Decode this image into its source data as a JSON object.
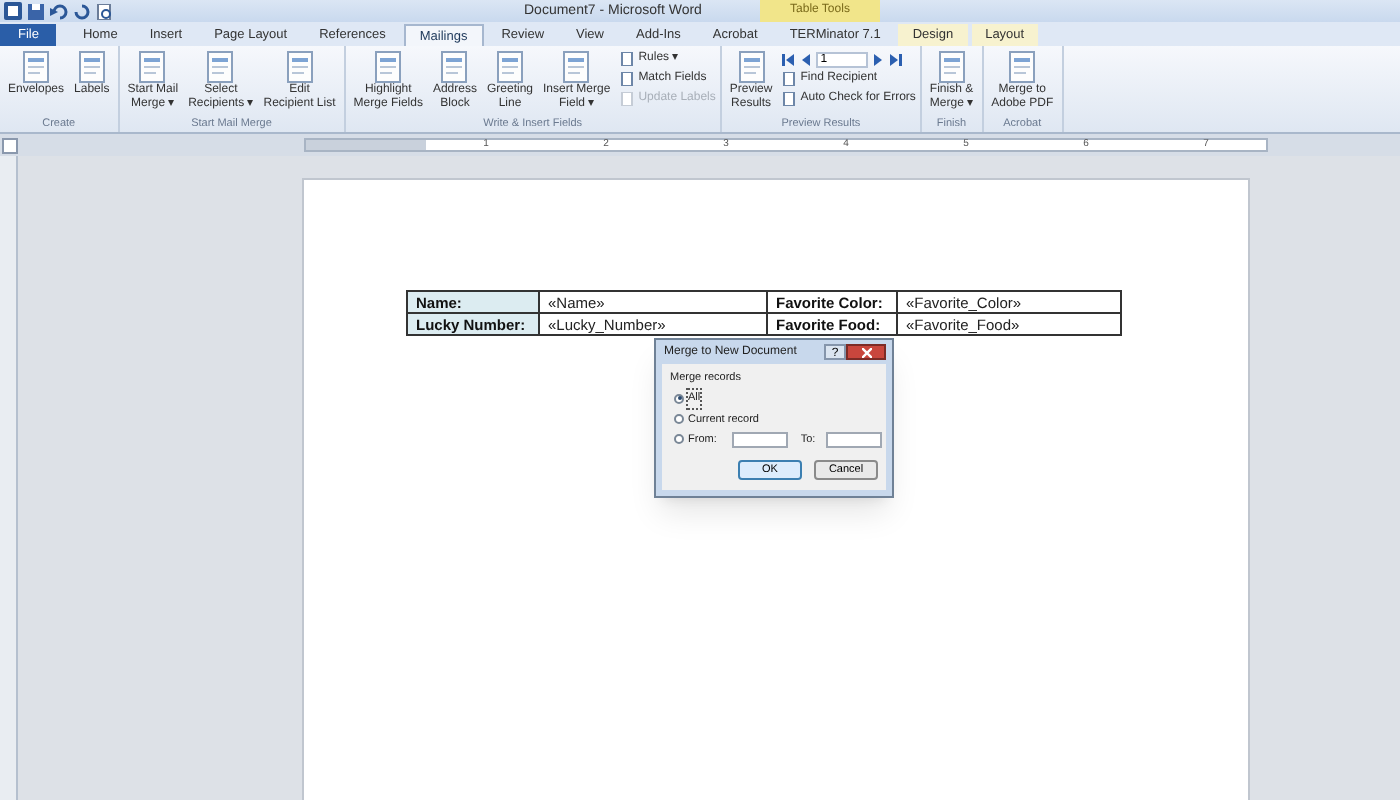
{
  "window": {
    "title": "Document7 - Microsoft Word"
  },
  "contextual_header": "Table Tools",
  "tabs": [
    {
      "label": "File",
      "kind": "file",
      "selected": false
    },
    {
      "label": "Home",
      "selected": false
    },
    {
      "label": "Insert",
      "selected": false
    },
    {
      "label": "Page Layout",
      "selected": false
    },
    {
      "label": "References",
      "selected": false
    },
    {
      "label": "Mailings",
      "selected": true
    },
    {
      "label": "Review",
      "selected": false
    },
    {
      "label": "View",
      "selected": false
    },
    {
      "label": "Add-Ins",
      "selected": false
    },
    {
      "label": "Acrobat",
      "selected": false
    },
    {
      "label": "TERMinator 7.1",
      "selected": false
    },
    {
      "label": "Design",
      "kind": "contextual",
      "selected": false
    },
    {
      "label": "Layout",
      "kind": "contextual",
      "selected": false
    }
  ],
  "ribbon_groups": [
    {
      "label": "Create",
      "items": [
        {
          "kind": "large",
          "lines": [
            "Envelopes"
          ]
        },
        {
          "kind": "large",
          "lines": [
            "Labels"
          ]
        }
      ]
    },
    {
      "label": "Start Mail Merge",
      "items": [
        {
          "kind": "large",
          "lines": [
            "Start Mail",
            "Merge ▾"
          ]
        },
        {
          "kind": "large",
          "lines": [
            "Select",
            "Recipients ▾"
          ]
        },
        {
          "kind": "large",
          "lines": [
            "Edit",
            "Recipient List"
          ]
        }
      ]
    },
    {
      "label": "Write & Insert Fields",
      "items": [
        {
          "kind": "large",
          "lines": [
            "Highlight",
            "Merge Fields"
          ]
        },
        {
          "kind": "large",
          "lines": [
            "Address",
            "Block"
          ]
        },
        {
          "kind": "large",
          "lines": [
            "Greeting",
            "Line"
          ]
        },
        {
          "kind": "large",
          "lines": [
            "Insert Merge",
            "Field ▾"
          ]
        },
        {
          "kind": "stack",
          "items": [
            {
              "label": "Rules ▾",
              "disabled": false
            },
            {
              "label": "Match Fields",
              "disabled": false
            },
            {
              "label": "Update Labels",
              "disabled": true
            }
          ]
        }
      ]
    },
    {
      "label": "Preview Results",
      "items": [
        {
          "kind": "large",
          "lines": [
            "Preview",
            "Results"
          ]
        },
        {
          "kind": "stack",
          "items": [
            {
              "kind": "nav",
              "value": "1"
            },
            {
              "label": "Find Recipient",
              "disabled": false
            },
            {
              "label": "Auto Check for Errors",
              "disabled": false
            }
          ]
        }
      ]
    },
    {
      "label": "Finish",
      "items": [
        {
          "kind": "large",
          "lines": [
            "Finish &",
            "Merge ▾"
          ]
        }
      ]
    },
    {
      "label": "Acrobat",
      "items": [
        {
          "kind": "large",
          "lines": [
            "Merge to",
            "Adobe PDF"
          ]
        }
      ]
    }
  ],
  "ruler_numbers": [
    "1",
    "2",
    "3",
    "4",
    "5",
    "6",
    "7"
  ],
  "table": {
    "rows": [
      [
        {
          "kind": "label",
          "text": "Name:"
        },
        {
          "kind": "field",
          "text": "«Name»"
        },
        {
          "kind": "label",
          "text": "Favorite Color:"
        },
        {
          "kind": "field",
          "text": "«Favorite_Color»"
        }
      ],
      [
        {
          "kind": "label",
          "text": "Lucky Number:"
        },
        {
          "kind": "field",
          "text": "«Lucky_Number»"
        },
        {
          "kind": "label",
          "text": "Favorite Food:"
        },
        {
          "kind": "field",
          "text": "«Favorite_Food»"
        }
      ]
    ]
  },
  "dialog": {
    "title": "Merge to New Document",
    "help": "?",
    "group_label": "Merge records",
    "options": [
      {
        "kind": "plain",
        "label": "All",
        "selected": true
      },
      {
        "kind": "plain",
        "label": "Current record",
        "selected": false
      },
      {
        "kind": "range",
        "label": "From:",
        "selected": false
      }
    ],
    "to_label": "To:",
    "buttons": [
      {
        "label": "OK",
        "default": true
      },
      {
        "label": "Cancel",
        "default": false
      }
    ]
  }
}
